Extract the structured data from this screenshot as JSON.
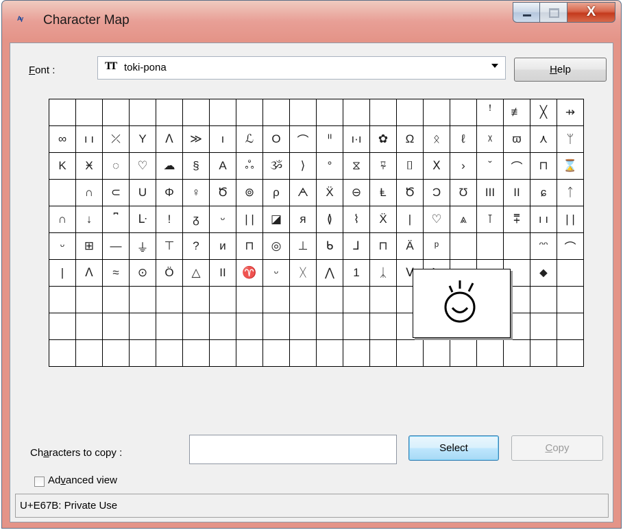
{
  "window": {
    "title": "Character Map",
    "icon": "character-map-app-icon",
    "controls": [
      "minimize",
      "maximize",
      "close"
    ]
  },
  "font": {
    "label_prefix": "",
    "label_mnemonic": "F",
    "label_rest": "ont :",
    "icon": "truetype-font-icon",
    "selected": "toki-pona"
  },
  "help_button": {
    "mnemonic": "H",
    "rest": "elp"
  },
  "grid": {
    "columns": 20,
    "rows": 10,
    "cells": [
      "",
      "",
      "",
      "",
      "",
      "",
      "",
      "",
      "",
      "",
      "",
      "",
      "",
      "",
      "",
      "",
      "ꜝ",
      "≢",
      "╳",
      "⇸",
      "∞",
      "ı ı",
      "⤫",
      "Y",
      "ᐱ",
      "≫",
      "ı",
      "ℒ",
      "Ο",
      "⌒",
      "ᑊᑊ",
      "ı·ı",
      "✿",
      "Ω",
      "ᛟ",
      "ℓ",
      "ᵡ",
      "ϖ",
      "⋏",
      "ᛘ",
      "K",
      "Ӿ",
      "◌",
      "♡",
      "☁",
      "§",
      "A",
      "ஃ",
      "ૐ",
      "⟩",
      "°",
      "⧖",
      "⍫",
      "⌷",
      "Ⅹ",
      "›",
      "ˇ",
      "⌒",
      "⊓",
      "⌛",
      "",
      "∩",
      "⊂",
      "U",
      "Φ",
      "♀",
      "Ծ",
      "⊚",
      "ρ",
      "ᗅ",
      "Ẍ",
      "⊖",
      "Ⱡ",
      "Ծ",
      "Ɔ",
      "Ʊ",
      "III",
      "II",
      "ɕ",
      "ᛏ",
      "∩",
      "↓",
      "⎴",
      "ᒷ",
      "!",
      "ᵹ",
      "ᵕ",
      "| |",
      "◪",
      "ᴙ",
      "≬",
      "⌇",
      "Ẍ",
      "|",
      "♡",
      "⩓",
      "⊺",
      "⩱",
      "ı ı",
      "| |",
      "ᵕ",
      "⊞",
      "—",
      "⏚",
      "⊤",
      "?",
      "ᴎ",
      "⊓",
      "◎",
      "⊥",
      "ᑲ",
      "⅃",
      "⊓",
      "Ä",
      "ᵖ",
      "",
      "",
      "",
      "ᵔᵔ",
      "⌒",
      "|",
      "ᐱ",
      "≈",
      "⊙",
      "Ö",
      "△",
      "II",
      "♈",
      "ᵕ",
      "ᚷ",
      "⋀",
      "1",
      "ᛣ",
      "ᐯ",
      "ᗒ",
      "",
      "",
      "",
      "⬥",
      "",
      "",
      "",
      "",
      "",
      "",
      "",
      "",
      "",
      "",
      "",
      "",
      "",
      "",
      "",
      "",
      "",
      "",
      "",
      "",
      "",
      "",
      "",
      "",
      "",
      "",
      "",
      "",
      "",
      "",
      "",
      "",
      "",
      "",
      "",
      "",
      "",
      "",
      "",
      "",
      "",
      "",
      "",
      "",
      "",
      "",
      "",
      "",
      "",
      "",
      "",
      "",
      "",
      "",
      "",
      "",
      "",
      "",
      "",
      "",
      "",
      ""
    ]
  },
  "zoom_preview": {
    "glyph": "sun-face-glyph",
    "code": "U+E67B"
  },
  "characters_to_copy": {
    "label_pre": "Ch",
    "label_mnemonic": "a",
    "label_post": "racters to copy :",
    "value": ""
  },
  "select_button": {
    "label": "Select"
  },
  "copy_button": {
    "mnemonic": "C",
    "rest": "opy"
  },
  "advanced_view": {
    "label_pre": "Ad",
    "label_mnemonic": "v",
    "label_post": "anced view",
    "checked": false
  },
  "status": {
    "text": "U+E67B: Private Use"
  }
}
